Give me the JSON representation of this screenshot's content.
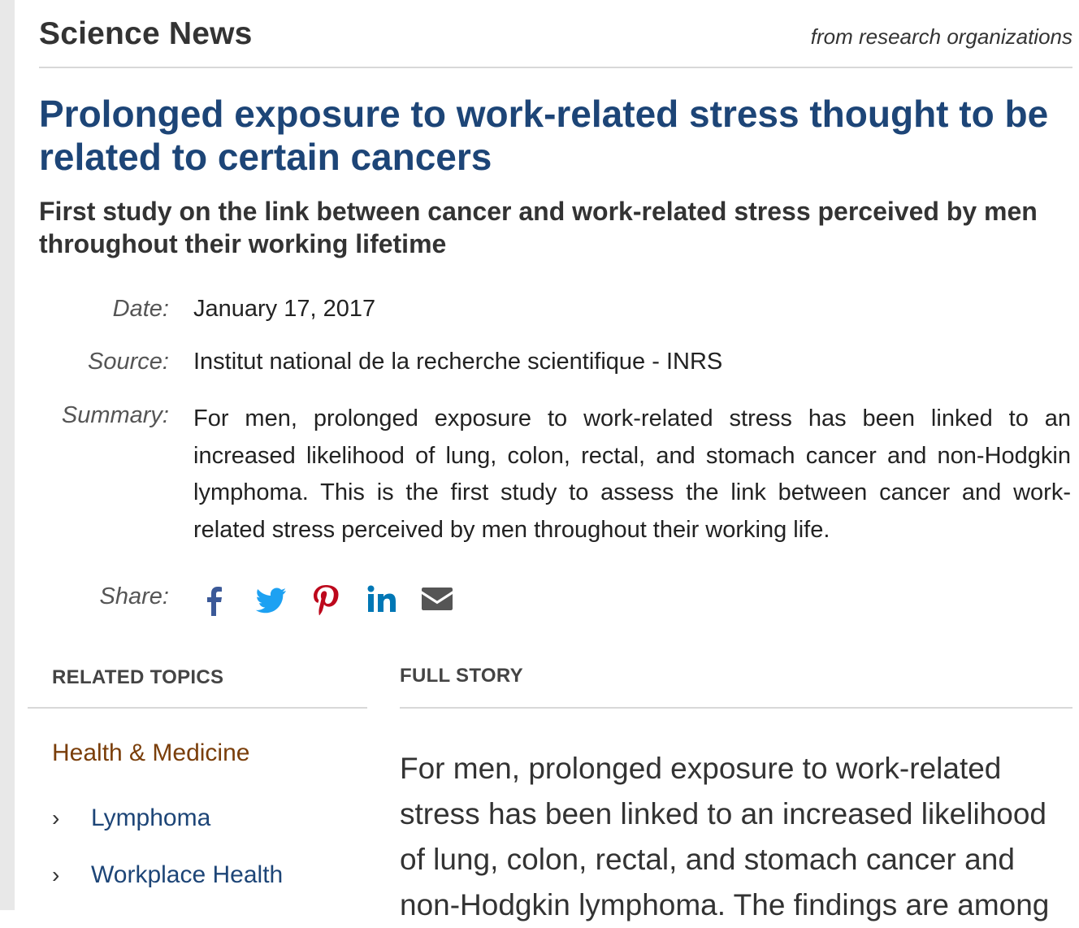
{
  "site": {
    "brand": "Science News",
    "tagline": "from research organizations"
  },
  "article": {
    "headline": "Prolonged exposure to work-related stress thought to be related to certain cancers",
    "subheadline": "First study on the link between cancer and work-related stress perceived by men throughout their working lifetime"
  },
  "meta": {
    "date_label": "Date:",
    "date_value": "January 17, 2017",
    "source_label": "Source:",
    "source_value": "Institut national de la recherche scientifique - INRS",
    "summary_label": "Summary:",
    "summary_value": "For men, prolonged exposure to work-related stress has been linked to an increased likelihood of lung, colon, rectal, and stomach cancer and non-Hodgkin lymphoma. This is the first study to assess the link between can­cer and work-related stress perceived by men throughout their working life."
  },
  "share": {
    "label": "Share:",
    "icons": [
      "facebook-icon",
      "twitter-icon",
      "pinterest-icon",
      "linkedin-icon",
      "email-icon"
    ],
    "colors": {
      "facebook": "#3b5998",
      "twitter": "#1da1f2",
      "pinterest": "#bd081c",
      "linkedin": "#0077b5",
      "email": "#555555"
    }
  },
  "related_topics": {
    "heading": "RELATED TOPICS",
    "category": "Health & Medicine",
    "links": [
      "Lymphoma",
      "Workplace Health"
    ]
  },
  "full_story": {
    "heading": "FULL STORY",
    "lines": [
      "For men, prolonged exposure to work-related",
      "stress has been linked to an increased likelihood",
      "of lung, colon, rectal, and stomach cancer and",
      "non-Hodgkin lymphoma. The findings are among"
    ]
  },
  "colors": {
    "headline": "#1d4577",
    "category": "#7a3e0a",
    "link": "#1d4577"
  }
}
